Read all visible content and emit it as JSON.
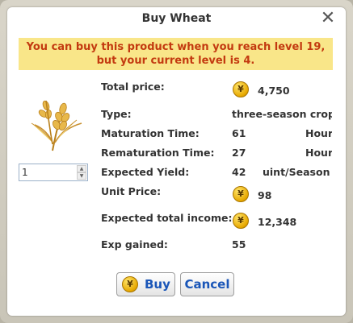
{
  "dialog": {
    "title": "Buy Wheat",
    "close_symbol": "✕",
    "warning": "You can buy this product when you reach level 19, but your current level is 4."
  },
  "product": {
    "icon": "wheat-icon",
    "quantity": "1"
  },
  "details": {
    "total_price": {
      "label": "Total price:",
      "value": "4,750"
    },
    "type": {
      "label": "Type:",
      "value": "three-season crop"
    },
    "maturation_time": {
      "label": "Maturation Time:",
      "value": "61",
      "unit": "Hours"
    },
    "rematuration_time": {
      "label": "Rematuration Time:",
      "value": "27",
      "unit": "Hours"
    },
    "expected_yield": {
      "label": "Expected Yield:",
      "value": "42",
      "unit": "uint/Season"
    },
    "unit_price": {
      "label": "Unit Price:",
      "value": "98"
    },
    "expected_income": {
      "label": "Expected total income:",
      "value": "12,348"
    },
    "exp_gained": {
      "label": "Exp gained:",
      "value": "55"
    }
  },
  "currency_symbol": "¥",
  "buttons": {
    "buy_label": "Buy",
    "cancel_label": "Cancel"
  },
  "colors": {
    "warning_bg": "#f9e689",
    "warning_text": "#c33a10",
    "button_text": "#1a56b8",
    "coin": "#e7a800"
  }
}
